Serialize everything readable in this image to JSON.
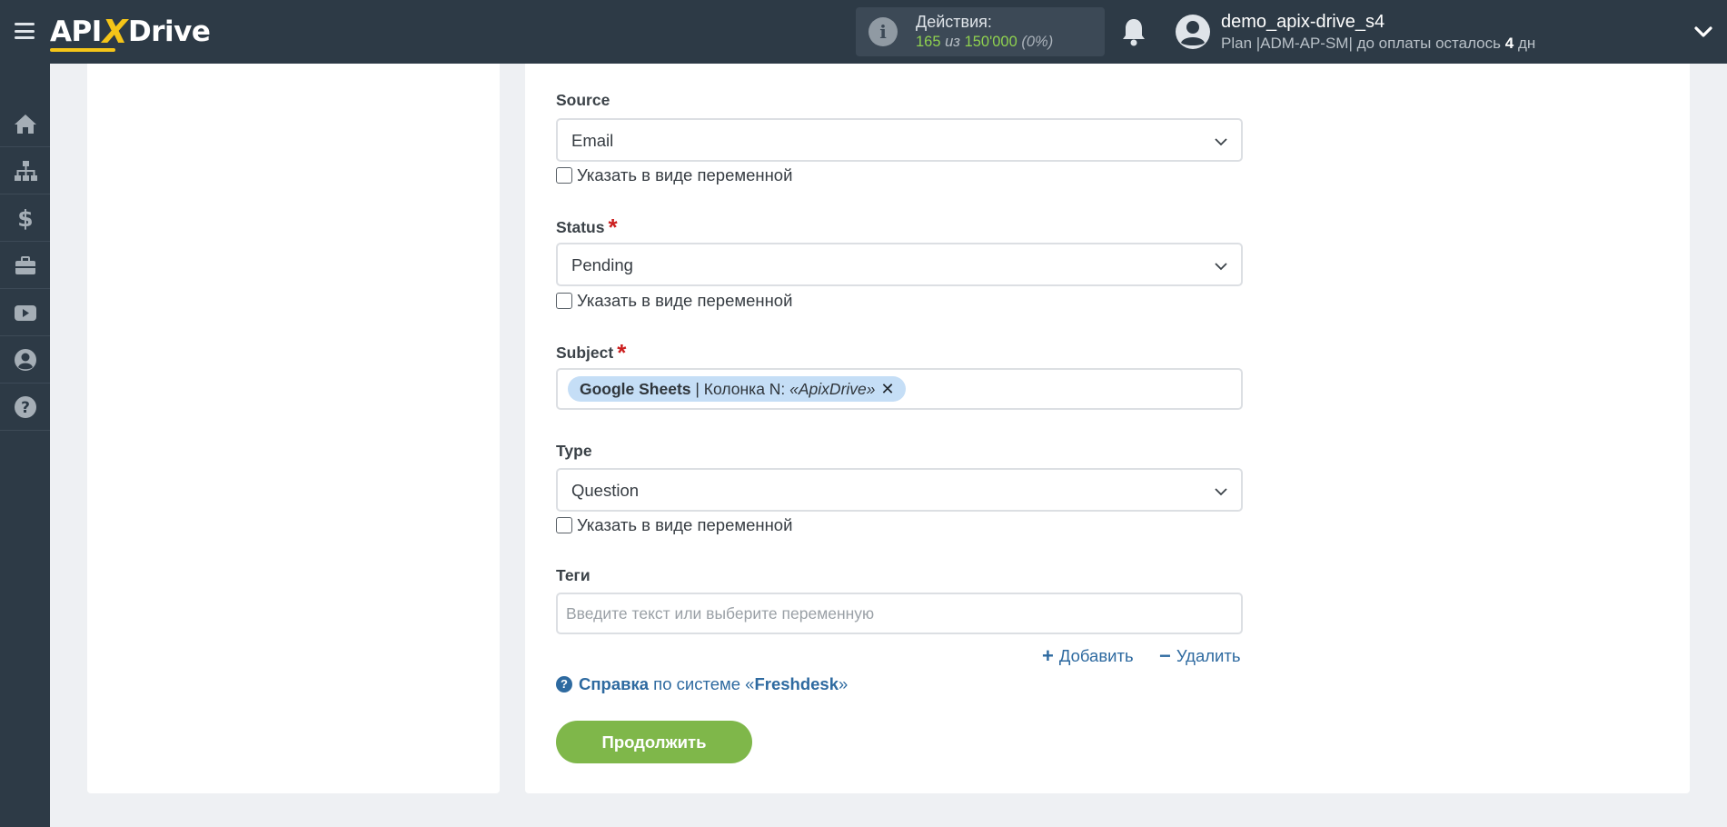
{
  "header": {
    "logo_text_1": "API",
    "logo_text_x": "X",
    "logo_text_2": "Drive",
    "actions_label": "Действия:",
    "actions_used": "165",
    "actions_of": "из",
    "actions_total": "150'000",
    "actions_percent": "(0%)",
    "user_name": "demo_apix-drive_s4",
    "plan_prefix": "Plan |ADM-AP-SM| до оплаты осталось",
    "plan_days": "4",
    "plan_suffix": "дн"
  },
  "sidebar": {
    "items": [
      {
        "icon": "home-icon"
      },
      {
        "icon": "sitemap-icon"
      },
      {
        "icon": "dollar-icon"
      },
      {
        "icon": "briefcase-icon"
      },
      {
        "icon": "youtube-icon"
      },
      {
        "icon": "user-circle-icon"
      },
      {
        "icon": "question-circle-icon"
      }
    ]
  },
  "form": {
    "source": {
      "label": "Source",
      "value": "Email",
      "var_label": "Указать в виде переменной"
    },
    "status": {
      "label": "Status",
      "required": "*",
      "value": "Pending",
      "var_label": "Указать в виде переменной"
    },
    "subject": {
      "label": "Subject",
      "required": "*",
      "chip_source": "Google Sheets",
      "chip_sep": " | Колонка N: ",
      "chip_value": "«ApixDrive»",
      "chip_remove": "✕"
    },
    "type": {
      "label": "Type",
      "value": "Question",
      "var_label": "Указать в виде переменной"
    },
    "tags": {
      "label": "Теги",
      "placeholder": "Введите текст или выберите переменную"
    },
    "add_label": "Добавить",
    "remove_label": "Удалить",
    "help_link": "Справка",
    "help_mid": " по системе «",
    "help_system": "Freshdesk",
    "help_end": "»",
    "continue_label": "Продолжить"
  },
  "colors": {
    "topbar": "#2d3a46",
    "accent_green": "#7fb74a",
    "link_blue": "#2e6aa0",
    "required_red": "#cc1f1f",
    "chip_blue": "#c5def6"
  }
}
